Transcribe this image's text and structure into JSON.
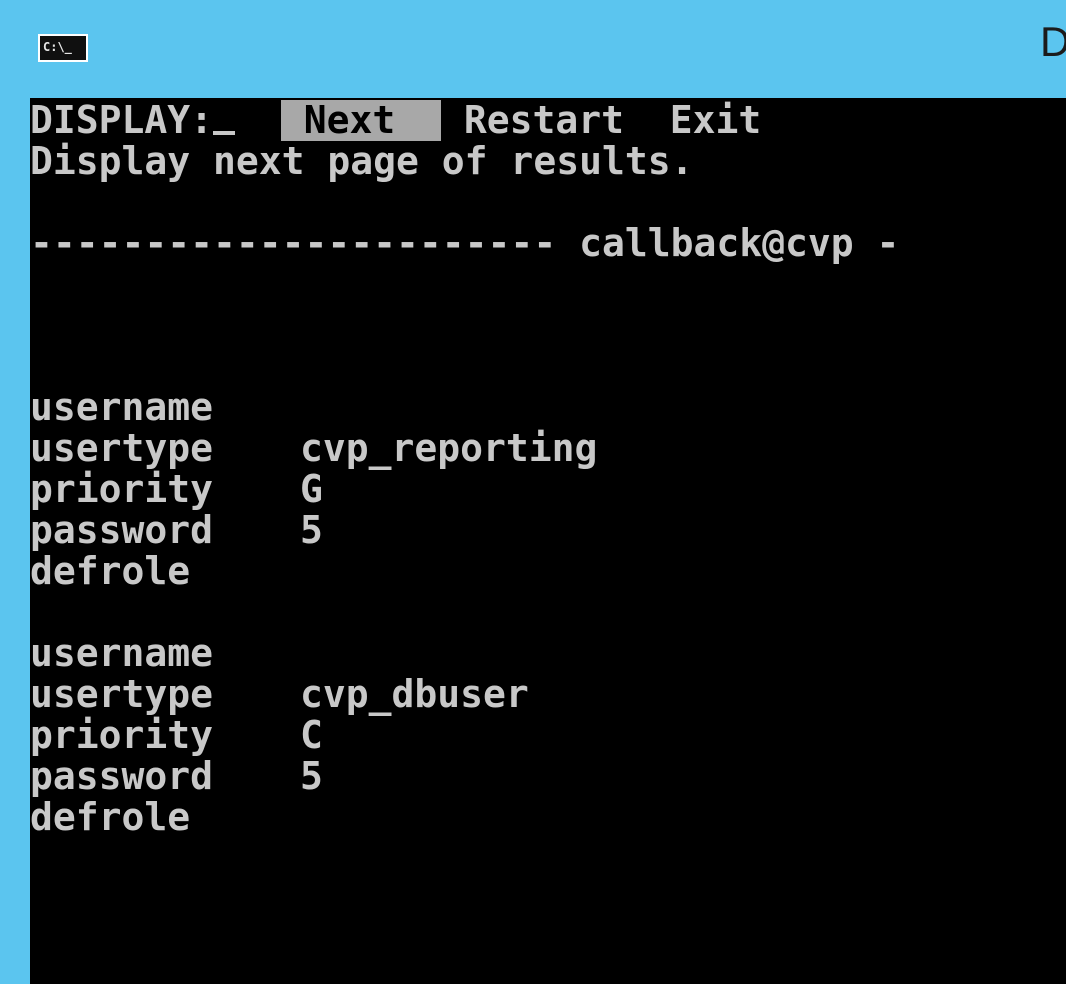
{
  "window": {
    "icon_label": "C:\\_",
    "title": "D"
  },
  "console": {
    "prompt": "DISPLAY:",
    "menu": [
      {
        "label": "Next",
        "selected": true
      },
      {
        "label": "Restart",
        "selected": false
      },
      {
        "label": "Exit",
        "selected": false
      }
    ],
    "description": "Display next page of results.",
    "separator": "----------------------- callback@cvp -",
    "records": [
      {
        "fields": [
          {
            "key": "username",
            "value": "cvp_reporting"
          },
          {
            "key": "usertype",
            "value": "G"
          },
          {
            "key": "priority",
            "value": "5"
          },
          {
            "key": "password",
            "value": ""
          },
          {
            "key": "defrole",
            "value": ""
          }
        ]
      },
      {
        "fields": [
          {
            "key": "username",
            "value": "cvp_dbuser"
          },
          {
            "key": "usertype",
            "value": "C"
          },
          {
            "key": "priority",
            "value": "5"
          },
          {
            "key": "password",
            "value": ""
          },
          {
            "key": "defrole",
            "value": ""
          }
        ]
      }
    ]
  },
  "colors": {
    "titlebar": "#5bc5ef",
    "console_bg": "#000000",
    "console_text": "#c8c8c8",
    "selected_bg": "#a8a8a8"
  }
}
